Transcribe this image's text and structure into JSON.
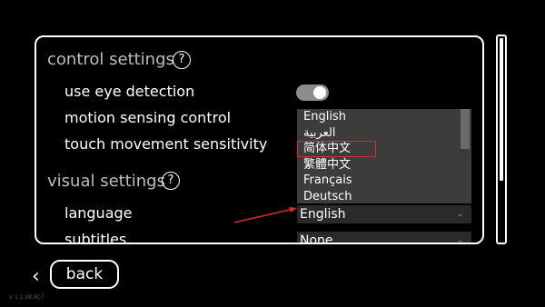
{
  "panel": {
    "control_section": {
      "title": "control settings",
      "help": "?"
    },
    "rows": {
      "eye_detection": "use eye detection",
      "motion_sensing": "motion sensing control",
      "touch_sensitivity": "touch movement sensitivity"
    },
    "eye_detection_on": true,
    "visual_section": {
      "title": "visual settings",
      "help": "?"
    },
    "language_label": "language",
    "subtitles_label": "subtitles",
    "language_value": "English",
    "subtitles_value": "None",
    "language_options": [
      "English",
      "العربية",
      "简体中文",
      "繁體中文",
      "Français",
      "Deutsch"
    ],
    "highlighted_option": "简体中文"
  },
  "nav": {
    "back_label": "back"
  },
  "version": "V 1.2.88.8C7",
  "colors": {
    "background": "#000000",
    "annotation_arrow": "#d32f2f",
    "toggle_on": "#8c8c8c"
  }
}
